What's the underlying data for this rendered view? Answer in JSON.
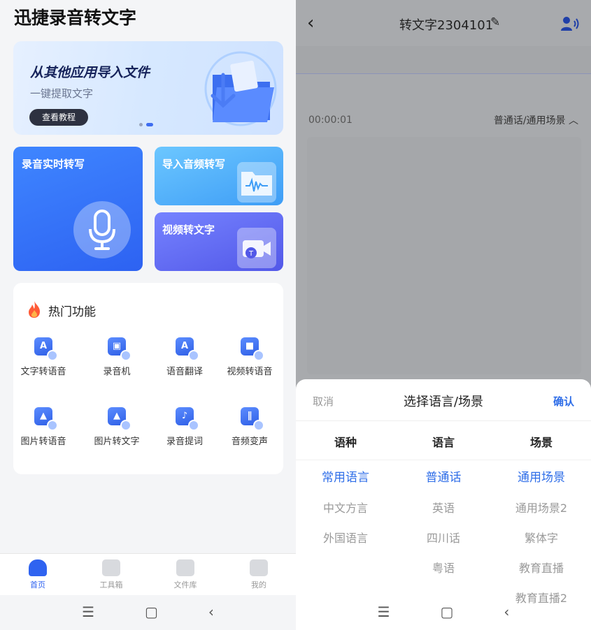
{
  "left": {
    "app_title": "迅捷录音转文字",
    "banner": {
      "title": "从其他应用导入文件",
      "subtitle": "一键提取文字",
      "button": "查看教程"
    },
    "cards": {
      "record": "录音实时转写",
      "import_audio": "导入音频转写",
      "video": "视频转文字"
    },
    "hot": {
      "title": "热门功能",
      "items": [
        {
          "label": "文字转语音",
          "glyph": "A",
          "icon": "text-to-speech-icon"
        },
        {
          "label": "录音机",
          "glyph": "▣",
          "icon": "recorder-icon"
        },
        {
          "label": "语音翻译",
          "glyph": "A",
          "icon": "voice-translate-icon"
        },
        {
          "label": "视频转语音",
          "glyph": "■",
          "icon": "video-to-speech-icon"
        },
        {
          "label": "图片转语音",
          "glyph": "▲",
          "icon": "image-to-speech-icon"
        },
        {
          "label": "图片转文字",
          "glyph": "▲",
          "icon": "image-to-text-icon"
        },
        {
          "label": "录音提词",
          "glyph": "♪",
          "icon": "teleprompter-icon"
        },
        {
          "label": "音频变声",
          "glyph": "∥",
          "icon": "voice-changer-icon"
        }
      ]
    },
    "tabs": [
      {
        "label": "首页",
        "active": true,
        "icon": "home-icon"
      },
      {
        "label": "工具箱",
        "active": false,
        "icon": "toolbox-icon"
      },
      {
        "label": "文件库",
        "active": false,
        "icon": "folder-icon"
      },
      {
        "label": "我的",
        "active": false,
        "icon": "profile-icon"
      }
    ]
  },
  "right": {
    "title": "转文字2304101",
    "edit_icon": "✎",
    "time": "00:00:01",
    "scene": "普通话/通用场景",
    "sheet": {
      "cancel": "取消",
      "title": "选择语言/场景",
      "confirm": "确认",
      "columns": [
        {
          "head": "语种",
          "options": [
            "常用语言",
            "中文方言",
            "外国语言"
          ],
          "selected": 0
        },
        {
          "head": "语言",
          "options": [
            "普通话",
            "英语",
            "四川话",
            "粤语"
          ],
          "selected": 0
        },
        {
          "head": "场景",
          "options": [
            "通用场景",
            "通用场景2",
            "繁体字",
            "教育直播",
            "教育直播2"
          ],
          "selected": 0
        }
      ]
    }
  },
  "system_nav": {
    "menu": "☰",
    "home": "▢",
    "back": "‹"
  },
  "colors": {
    "accent": "#2f63f0",
    "confirm": "#2f6ee8"
  }
}
